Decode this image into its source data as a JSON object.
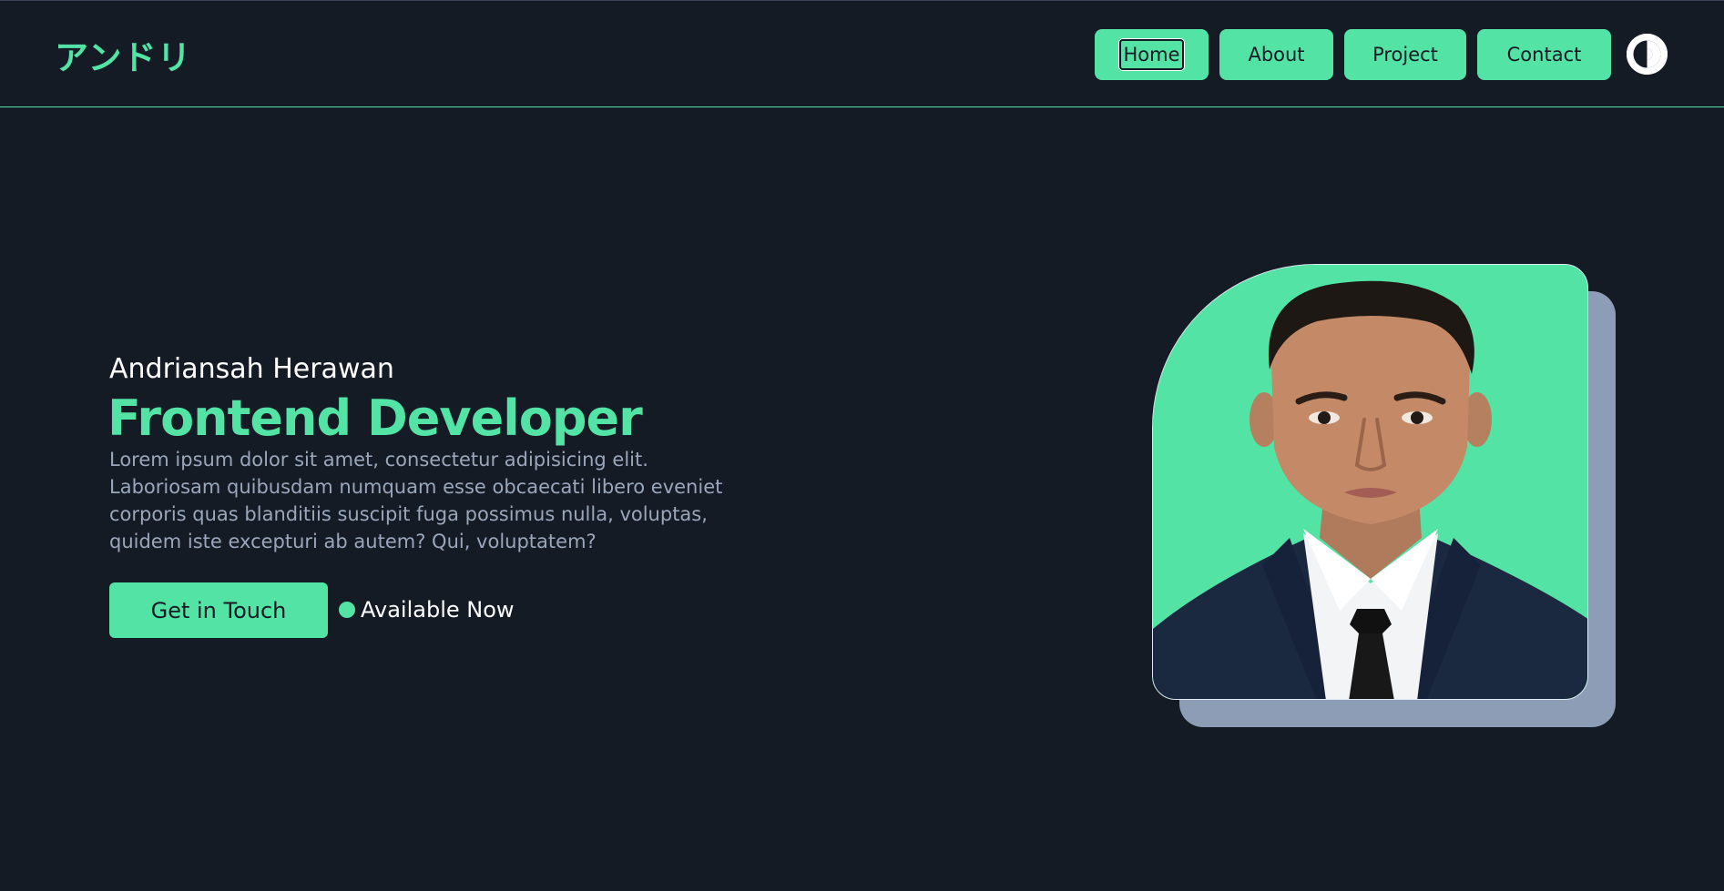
{
  "header": {
    "logo": "アンドリ",
    "nav": {
      "home": "Home",
      "about": "About",
      "project": "Project",
      "contact": "Contact"
    },
    "theme_toggle_icon": "contrast-icon"
  },
  "hero": {
    "name": "Andriansah Herawan",
    "title": "Frontend Developer",
    "description": "Lorem ipsum dolor sit amet, consectetur adipisicing elit. Laboriosam quibusdam numquam esse obcaecati libero eveniet corporis quas blanditiis suscipit fuga possimus nulla, voluptas, quidem iste excepturi ab autem? Qui, voluptatem?",
    "cta_label": "Get in Touch",
    "status_label": "Available Now",
    "photo": "profile-photo"
  },
  "colors": {
    "background": "#151b25",
    "accent": "#52e3a5",
    "muted_text": "#9aa7bb",
    "photo_shadow": "#8d9db5"
  }
}
